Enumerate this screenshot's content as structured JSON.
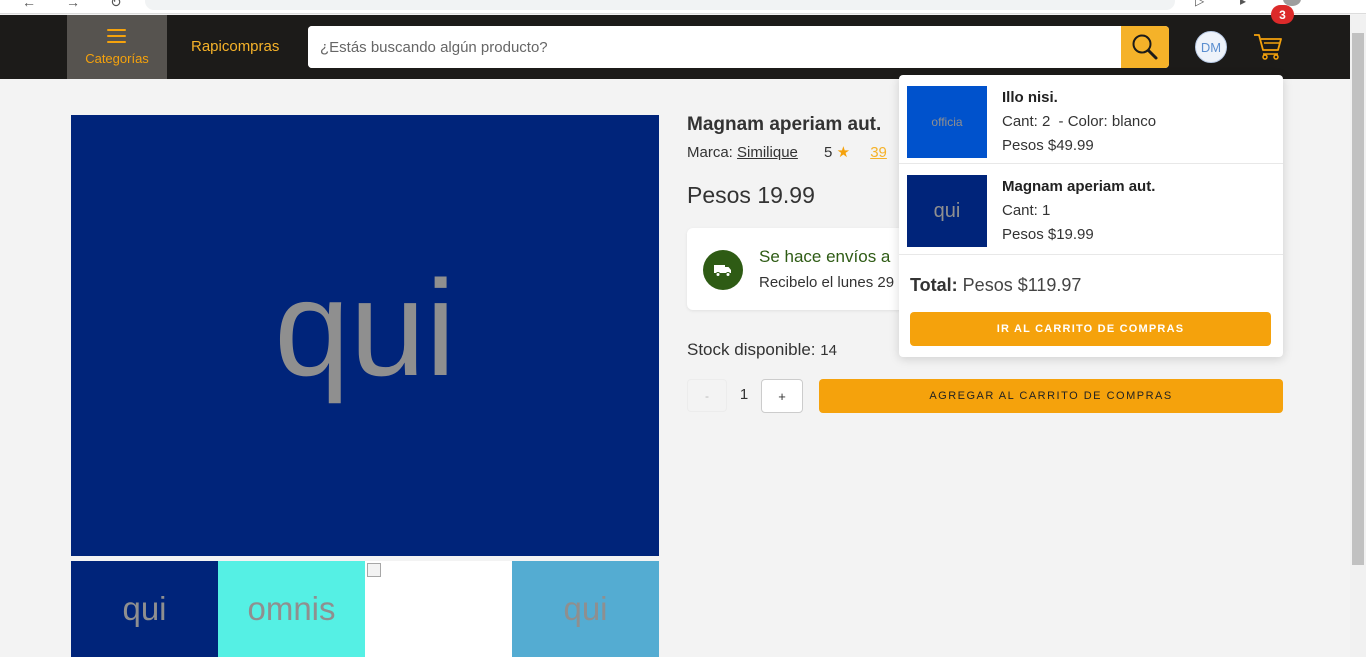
{
  "header": {
    "categories_label": "Categorías",
    "brand": "Rapicompras",
    "search_placeholder": "¿Estás buscando algún producto?",
    "user_initials": "DM",
    "cart_count": "3"
  },
  "gallery": {
    "main_image_text": "qui",
    "main_image_color": "#00247a",
    "thumbnails": [
      {
        "text": "qui",
        "color": "#00247a"
      },
      {
        "text": "omnis",
        "color": "#55f0e4"
      },
      {
        "text": "",
        "color": "#ffffff"
      },
      {
        "text": "qui",
        "color": "#54acd2"
      }
    ]
  },
  "product": {
    "title": "Magnam aperiam aut.",
    "brand_label": "Marca:",
    "brand_name": "Similique",
    "rating": "5",
    "reviews_count": "39",
    "price": "Pesos 19.99",
    "shipping_title": "Se hace envíos a",
    "shipping_subtitle": "Recibelo el lunes 29",
    "stock_label": "Stock disponible:",
    "stock_value": "14",
    "qty_minus": "-",
    "quantity": "1",
    "qty_plus": "+",
    "add_to_cart": "AGREGAR AL CARRITO DE COMPRAS"
  },
  "cart_dropdown": {
    "items": [
      {
        "name": "Illo nisi.",
        "qty": "Cant: 2",
        "color_text": "- Color: blanco",
        "price": "Pesos $49.99",
        "image_text": "officia",
        "image_color": "#0052cc"
      },
      {
        "name": "Magnam aperiam aut.",
        "qty": "Cant: 1",
        "price": "Pesos $19.99",
        "image_text": "qui",
        "image_color": "#00247a"
      }
    ],
    "total_label": "Total:",
    "total_value": "Pesos $119.97",
    "go_to_cart": "IR AL CARRITO DE COMPRAS"
  },
  "colors": {
    "header_bg": "#1c1b19",
    "accent": "#f5a20c",
    "brand_text": "#f5b229",
    "badge": "#dc2a2a",
    "shipping_green": "#2e5b14"
  }
}
